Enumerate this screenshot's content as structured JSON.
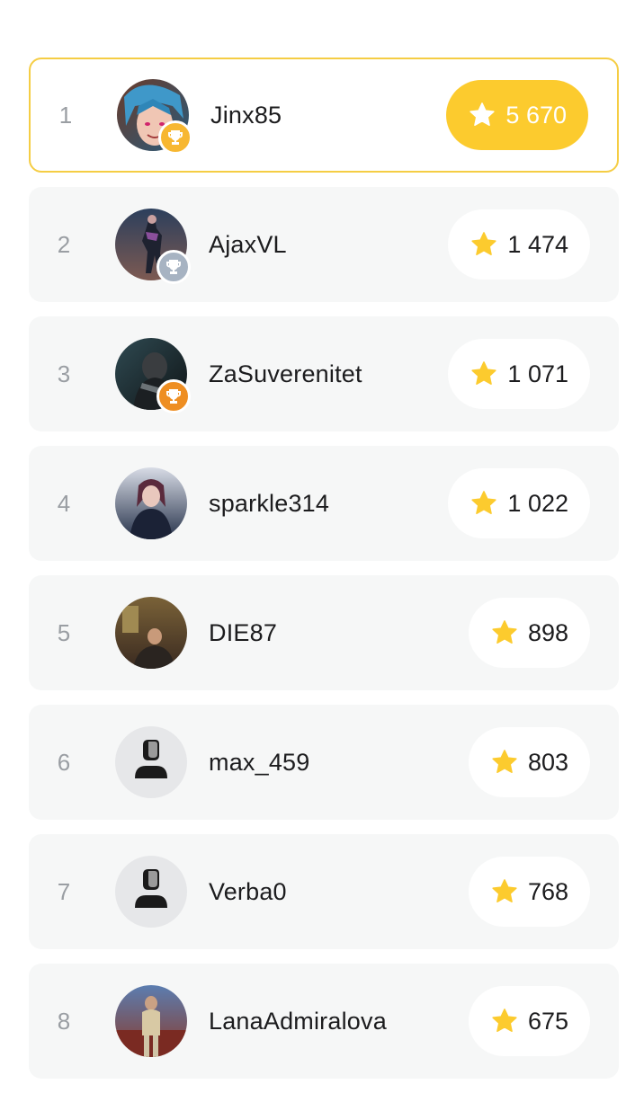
{
  "leaderboard": {
    "rows": [
      {
        "rank": "1",
        "name": "Jinx85",
        "score": "5 670",
        "avatar": "photo-avatar",
        "trophy": "gold"
      },
      {
        "rank": "2",
        "name": "AjaxVL",
        "score": "1 474",
        "avatar": "photo-avatar",
        "trophy": "silver"
      },
      {
        "rank": "3",
        "name": "ZaSuverenitet",
        "score": "1 071",
        "avatar": "photo-avatar",
        "trophy": "bronze"
      },
      {
        "rank": "4",
        "name": "sparkle314",
        "score": "1 022",
        "avatar": "photo-avatar"
      },
      {
        "rank": "5",
        "name": "DIE87",
        "score": "898",
        "avatar": "photo-avatar"
      },
      {
        "rank": "6",
        "name": "max_459",
        "score": "803",
        "avatar": "default-user-icon"
      },
      {
        "rank": "7",
        "name": "Verba0",
        "score": "768",
        "avatar": "default-user-icon"
      },
      {
        "rank": "8",
        "name": "LanaAdmiralova",
        "score": "675",
        "avatar": "photo-avatar"
      }
    ]
  },
  "colors": {
    "accent": "#fccb2e",
    "leader_border": "#f5cd44",
    "row_bg": "#f6f7f7",
    "rank_text": "#9a9ea3",
    "trophy_gold": "#f7b731",
    "trophy_silver": "#a7b3c2",
    "trophy_bronze": "#ee8e22"
  }
}
